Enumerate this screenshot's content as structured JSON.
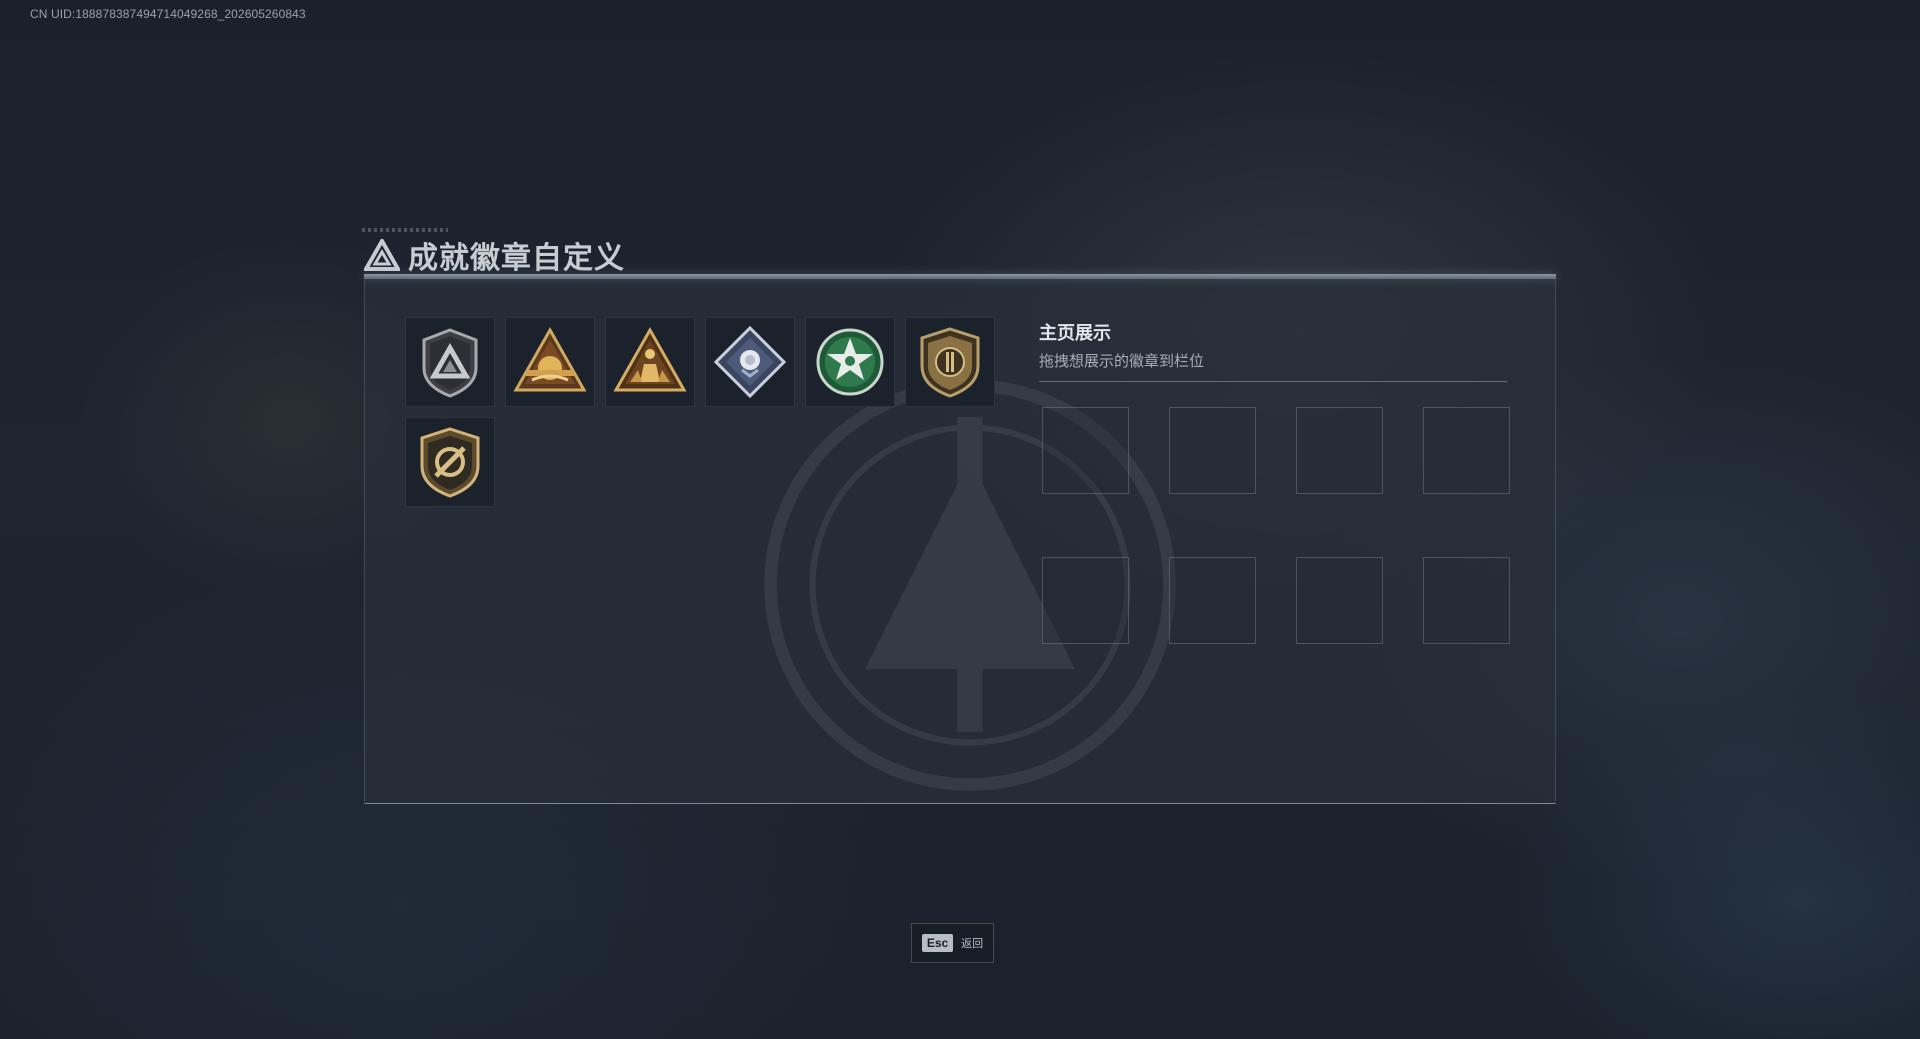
{
  "uid": "CN UID:1888783874947140492​68_202605260843",
  "window": {
    "title": "成就徽章自定义"
  },
  "badges": [
    {
      "name": "grey-triangle-shield-badge-icon"
    },
    {
      "name": "gold-triangle-sunrise-badge-icon"
    },
    {
      "name": "gold-triangle-figure-badge-icon"
    },
    {
      "name": "silver-diamond-rose-badge-icon"
    },
    {
      "name": "green-star-emblem-badge-icon"
    },
    {
      "name": "bronze-shield-crest-badge-icon"
    },
    {
      "name": "bronze-shield-target-badge-icon"
    }
  ],
  "showcase": {
    "title": "主页展示",
    "subtitle": "拖拽想展示的徽章到栏位",
    "slot_count": 8
  },
  "footer": {
    "esc_key": "Esc",
    "esc_label": "返回"
  },
  "colors": {
    "panel_bg": "#282f3a",
    "accent_gold": "#c9a45a",
    "accent_green": "#2f7a4d"
  }
}
